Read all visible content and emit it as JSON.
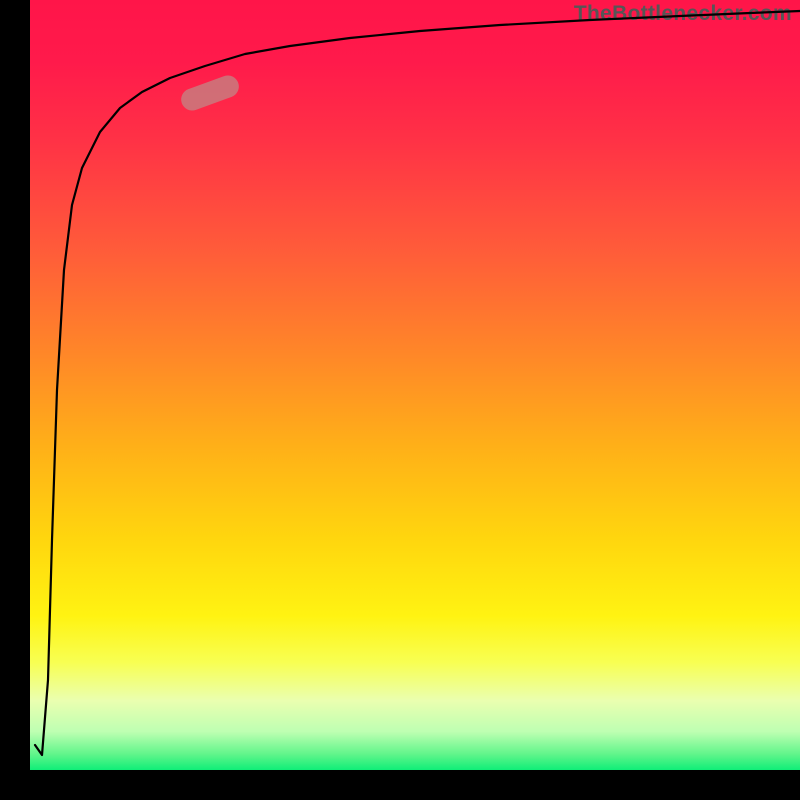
{
  "attribution": "TheBottlenecker.com",
  "colors": {
    "axis": "#000000",
    "curve": "#000000",
    "marker": "#c48383",
    "gradient_top": "#ff1549",
    "gradient_mid": "#ffd60e",
    "gradient_bottom": "#0fee78"
  },
  "chart_data": {
    "type": "line",
    "title": "",
    "xlabel": "",
    "ylabel": "",
    "xlim": [
      0,
      100
    ],
    "ylim": [
      0,
      100
    ],
    "x": [
      0,
      1,
      2,
      2.5,
      3,
      4,
      5,
      6,
      8,
      10,
      12,
      15,
      20,
      25,
      30,
      40,
      50,
      60,
      70,
      80,
      90,
      100
    ],
    "y": [
      3,
      2,
      10,
      30,
      50,
      65,
      73,
      78,
      83,
      86,
      88,
      90,
      92,
      93.5,
      94.5,
      96,
      97,
      97.7,
      98.2,
      98.6,
      99,
      99.3
    ],
    "marker": {
      "x_range": [
        21,
        28
      ],
      "y_range": [
        83,
        88
      ]
    }
  }
}
